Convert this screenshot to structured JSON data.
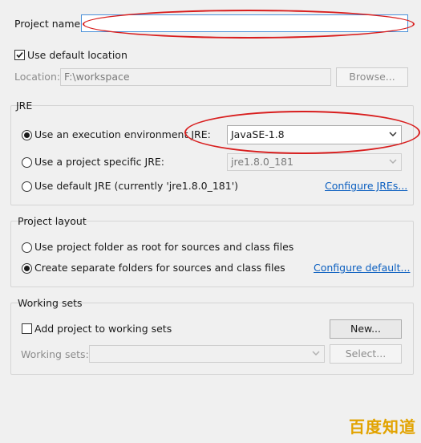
{
  "project_name": {
    "label": "Project name:",
    "value": ""
  },
  "default_location": {
    "label": "Use default location",
    "checked": true
  },
  "location": {
    "label": "Location:",
    "value": "F:\\workspace",
    "browse_label": "Browse..."
  },
  "jre": {
    "title": "JRE",
    "exec_env_label": "Use an execution environment JRE:",
    "exec_env_value": "JavaSE-1.8",
    "project_specific_label": "Use a project specific JRE:",
    "project_specific_value": "jre1.8.0_181",
    "default_label": "Use default JRE (currently 'jre1.8.0_181')",
    "configure_link": "Configure JREs..."
  },
  "project_layout": {
    "title": "Project layout",
    "option_root_label": "Use project folder as root for sources and class files",
    "option_separate_label": "Create separate folders for sources and class files",
    "configure_link": "Configure default..."
  },
  "working_sets": {
    "title": "Working sets",
    "add_label": "Add project to working sets",
    "new_button": "New...",
    "sets_label": "Working sets:",
    "select_button": "Select..."
  },
  "watermark": {
    "text": "百度知道"
  },
  "colors": {
    "annotation": "#d81e1e",
    "link": "#0b5fc0",
    "watermark": "#e2a300"
  }
}
